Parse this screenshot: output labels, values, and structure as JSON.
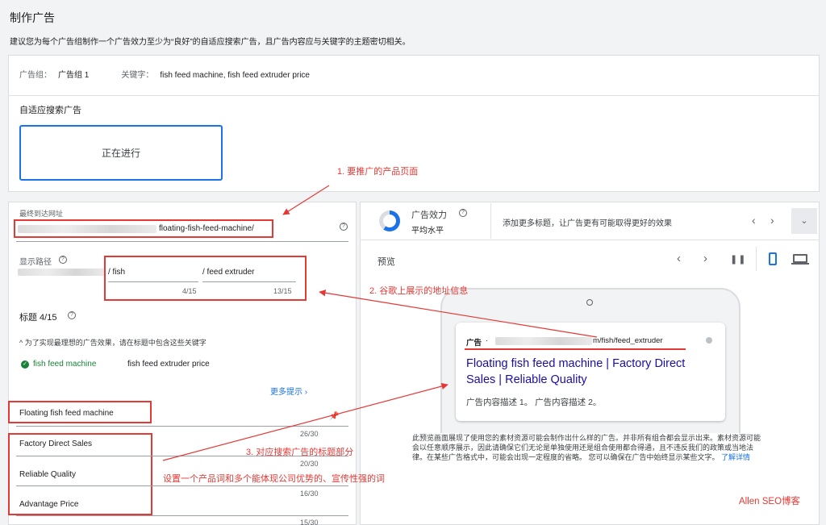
{
  "page": {
    "title": "制作广告",
    "subtitle": "建议您为每个广告组制作一个广告效力至少为“良好”的自适应搜索广告，且广告内容应与关键字的主题密切相关。"
  },
  "ad_group": {
    "label": "广告组：",
    "value": "广告组 1",
    "keyword_label": "关键字：",
    "keyword_value": "fish feed machine, fish feed extruder price"
  },
  "rsa": {
    "title": "自适应搜索广告",
    "status_button": "正在进行"
  },
  "final_url": {
    "label": "最终到达网址",
    "value_suffix": "floating-fish-feed-machine/"
  },
  "display_path": {
    "label": "显示路径",
    "path1": "/ fish",
    "path1_count": "4/15",
    "path2": "/ feed extruder",
    "path2_count": "13/15"
  },
  "headlines": {
    "label": "标题 4/15",
    "hint": "为了实现最理想的广告效果，请在标题中包含这些关键字",
    "kw1": "fish feed machine",
    "kw2": "fish feed extruder price",
    "more_tips": "更多提示",
    "items": [
      {
        "text": "Floating fish feed machine",
        "count": "26/30"
      },
      {
        "text": "Factory Direct Sales",
        "count": "20/30"
      },
      {
        "text": "Reliable Quality",
        "count": "16/30"
      },
      {
        "text": "Advantage Price",
        "count": "15/30"
      }
    ]
  },
  "strength": {
    "label": "广告效力",
    "value": "平均水平",
    "tip": "添加更多标题，让广告更有可能取得更好的效果"
  },
  "preview": {
    "label": "预览",
    "ad_label": "广告",
    "ad_url_suffix": "m/fish/feed_extruder",
    "ad_title": "Floating fish feed machine | Factory Direct Sales | Reliable Quality",
    "ad_desc": "广告内容描述 1。 广告内容描述 2。",
    "note": "此预览画面展现了使用您的素材资源可能会制作出什么样的广告。并非所有组合都会显示出来。素材资源可能会以任意顺序展示，因此请确保它们无论是单独使用还是组合使用都合得通，且不违反我们的政策或当地法律。在某些广告格式中，可能会出现一定程度的省略。 您可以确保在广告中始终显示某些文字。",
    "learn_more": "了解详情"
  },
  "annotations": {
    "a1": "1. 要推广的产品页面",
    "a2": "2. 谷歌上展示的地址信息",
    "a3": "3. 对应搜索广告的标题部分",
    "a3b": "设置一个产品词和多个能体现公司优势的、宣传性强的词",
    "watermark": "Allen SEO博客"
  },
  "colors": {
    "accent": "#1a73e8",
    "annotation_red": "#e53935",
    "ad_title_blue": "#1a0dab",
    "ok_green": "#188038"
  }
}
